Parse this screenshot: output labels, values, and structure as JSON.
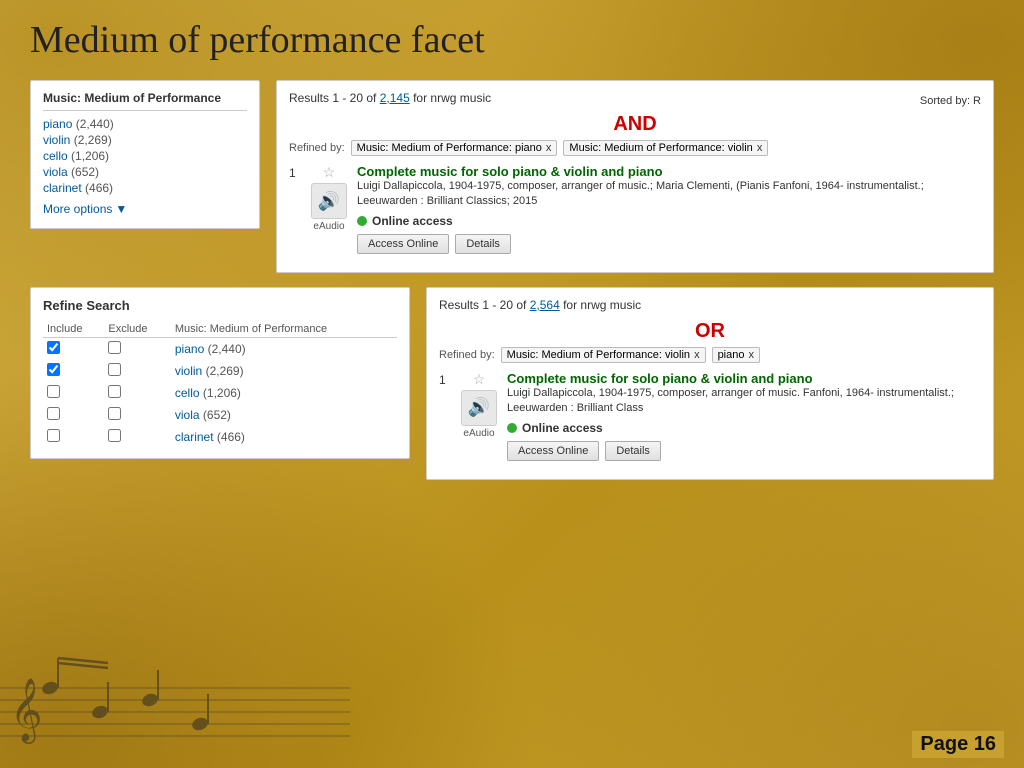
{
  "page": {
    "title": "Medium of performance facet",
    "page_number": "Page 16"
  },
  "facet_panel": {
    "heading": "Music: Medium of Performance",
    "items": [
      {
        "label": "piano",
        "count": "(2,440)"
      },
      {
        "label": "violin",
        "count": "(2,269)"
      },
      {
        "label": "cello",
        "count": "(1,206)"
      },
      {
        "label": "viola",
        "count": "(652)"
      },
      {
        "label": "clarinet",
        "count": "(466)"
      }
    ],
    "more_options": "More options"
  },
  "top_result": {
    "header": "Results 1 - 20 of",
    "count": "2,145",
    "for_text": "for nrwg music",
    "sorted_by": "Sorted by: R",
    "and_label": "AND",
    "refined_by": "Refined by:",
    "tags": [
      {
        "label": "Music: Medium of Performance: piano",
        "x": "x"
      },
      {
        "label": "Music: Medium of Performance: violin",
        "x": "x"
      }
    ],
    "item": {
      "number": "1",
      "title": "Complete music for solo piano & violin and piano",
      "meta": "Luigi Dallapiccola, 1904-1975, composer, arranger of music.; Maria Clementi, (Pianis Fanfoni, 1964- instrumentalist.; Leeuwarden : Brilliant Classics; 2015",
      "online_access": "Online access",
      "format": "eAudio",
      "btn_access": "Access Online",
      "btn_details": "Details"
    }
  },
  "refine_panel": {
    "heading": "Refine Search",
    "col_include": "Include",
    "col_exclude": "Exclude",
    "col_facet": "Music: Medium of Performance",
    "items": [
      {
        "include": true,
        "exclude": false,
        "label": "piano",
        "count": "(2,440)"
      },
      {
        "include": true,
        "exclude": false,
        "label": "violin",
        "count": "(2,269)"
      },
      {
        "include": false,
        "exclude": false,
        "label": "cello",
        "count": "(1,206)"
      },
      {
        "include": false,
        "exclude": false,
        "label": "viola",
        "count": "(652)"
      },
      {
        "include": false,
        "exclude": false,
        "label": "clarinet",
        "count": "(466)"
      }
    ]
  },
  "bottom_result": {
    "header": "Results 1 - 20 of",
    "count": "2,564",
    "for_text": "for nrwg music",
    "or_label": "OR",
    "refined_by": "Refined by:",
    "tags": [
      {
        "label": "Music: Medium of Performance: violin",
        "x": "x"
      },
      {
        "label": "piano",
        "x": "x"
      }
    ],
    "item": {
      "number": "1",
      "title": "Complete music for solo piano & violin and piano",
      "meta": "Luigi Dallapiccola, 1904-1975, composer, arranger of music. Fanfoni, 1964- instrumentalist.; Leeuwarden : Brilliant Class",
      "online_access": "Online access",
      "format": "eAudio",
      "btn_access": "Access Online",
      "btn_details": "Details"
    }
  }
}
